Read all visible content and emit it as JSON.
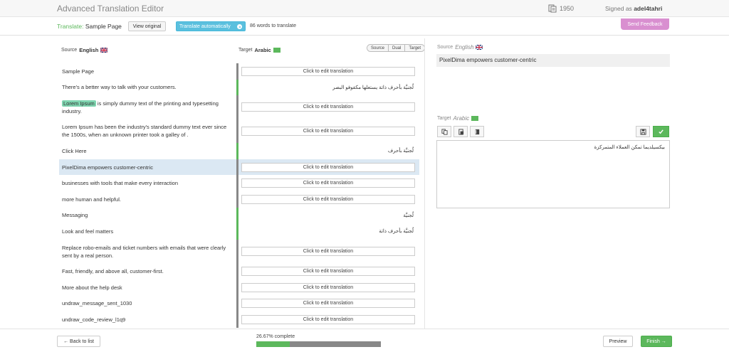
{
  "header": {
    "app_title": "Advanced Translation Editor",
    "counter_value": "1950",
    "signed_prefix": "Signed as",
    "username": "adel4tahri"
  },
  "toolbar": {
    "translate_label": "Translate:",
    "page_name": "Sample Page",
    "view_original": "View original",
    "translate_auto": "Translate automatically",
    "words_to_translate": "86 words to translate",
    "send_feedback": "Send Feedback"
  },
  "columns": {
    "source_label": "Source",
    "source_lang": "English",
    "target_label": "Target",
    "target_lang": "Arabic",
    "view_modes": [
      "Source",
      "Dual",
      "Target"
    ]
  },
  "rows": [
    {
      "source": "Sample Page",
      "target": "",
      "status": "pending",
      "lines": 1
    },
    {
      "source": "There's a better way to talk with your customers.",
      "target": "لُجنيَّة بأحرف ذاتة يستعلها مكفوفو البصر",
      "status": "done",
      "lines": 1
    },
    {
      "source_hl": "Lorem Ipsum",
      "source": " is simply dummy text of the printing and typesetting industry.",
      "target": "",
      "status": "pending",
      "lines": 2
    },
    {
      "source": "Lorem Ipsum has been the industry's standard dummy text ever since the 1500s, when an unknown printer took a galley of .",
      "target": "",
      "status": "pending",
      "lines": 2
    },
    {
      "source": "Click Here",
      "target": "لُجنيَّة بأحرف",
      "status": "done",
      "lines": 1
    },
    {
      "source": "PixelDima empowers customer-centric",
      "target": "",
      "status": "active",
      "lines": 1
    },
    {
      "source": "businesses with tools that make every interaction",
      "target": "",
      "status": "pending",
      "lines": 1
    },
    {
      "source": "more human and helpful.",
      "target": "",
      "status": "pending",
      "lines": 1
    },
    {
      "source": "Messaging",
      "target": "لُجنيَّة",
      "status": "done",
      "lines": 1
    },
    {
      "source": "Look and feel matters",
      "target": "لُجنيَّة بأحرف ذاتة",
      "status": "done",
      "lines": 1
    },
    {
      "source": "Replace robo-emails and ticket numbers with emails that were clearly sent by a real person.",
      "target": "",
      "status": "pending",
      "lines": 2
    },
    {
      "source": "Fast, friendly, and above all, customer-first.",
      "target": "",
      "status": "pending",
      "lines": 1
    },
    {
      "source": "More about the help desk",
      "target": "",
      "status": "pending",
      "lines": 1
    },
    {
      "source": "undraw_message_sent_1030",
      "target": "",
      "status": "pending",
      "lines": 1
    },
    {
      "source": "undraw_code_review_l1q9",
      "target": "",
      "status": "pending",
      "lines": 1
    }
  ],
  "edit_placeholder": "Click to edit translation",
  "right_panel": {
    "source_label": "Source",
    "source_lang": "English",
    "source_text": "PixelDima empowers customer-centric",
    "target_label": "Target",
    "target_lang": "Arabic",
    "target_text": "بيكسيلديما تمكن العملاء المتمركزة"
  },
  "footer": {
    "back": "← Back to list",
    "progress_text": "26.67% complete",
    "progress_fraction": 0.2667,
    "preview": "Preview",
    "finish": "Finish →"
  },
  "colors": {
    "green": "#5cb85c",
    "blue": "#5bc0de",
    "feedback": "#d98fd0",
    "active_row": "#dbe8f3"
  }
}
